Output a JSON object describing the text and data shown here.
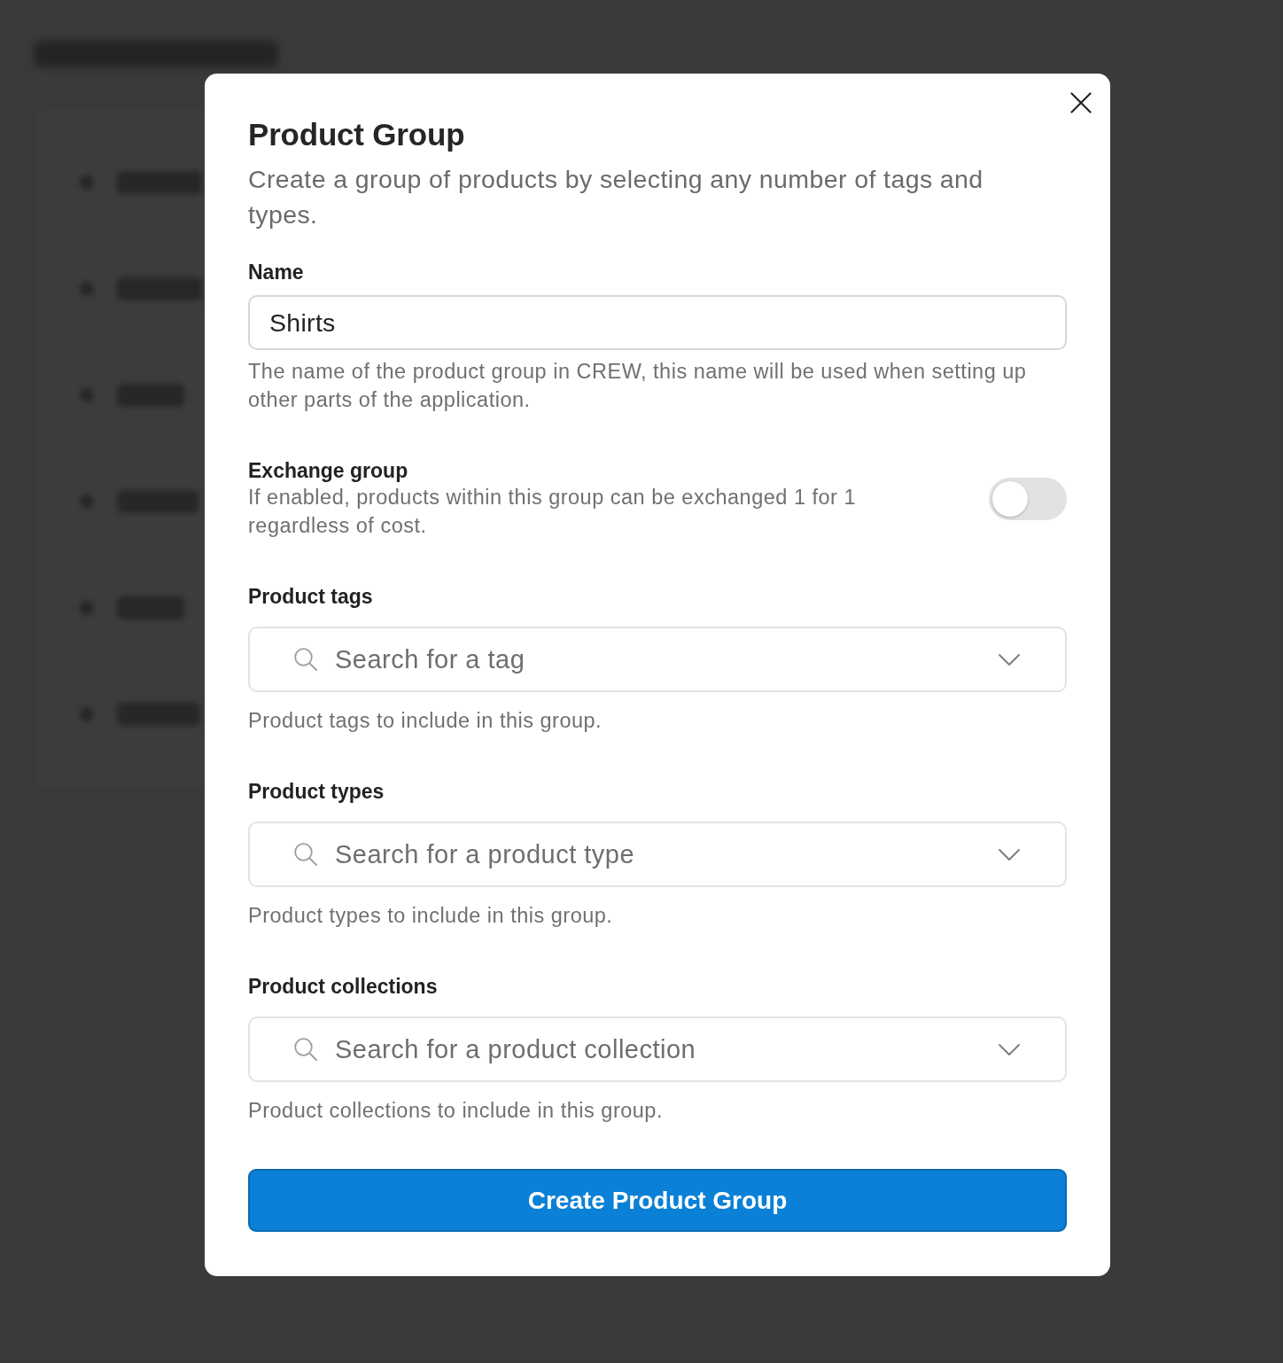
{
  "dialog": {
    "title": "Product Group",
    "subtitle": "Create a group of products by selecting any number of tags and types."
  },
  "fields": [
    {
      "kind": "text",
      "label": "Name",
      "value": "Shirts",
      "help": "The name of the product group in CREW, this name will be used when setting up other parts of the application."
    },
    {
      "kind": "toggle",
      "label": "Exchange group",
      "description": "If enabled, products within this group can be exchanged 1 for 1 regardless of cost.",
      "on": false
    },
    {
      "kind": "select",
      "label": "Product tags",
      "placeholder": "Search for a tag",
      "help": "Product tags to include in this group."
    },
    {
      "kind": "select",
      "label": "Product types",
      "placeholder": "Search for a product type",
      "help": "Product types to include in this group."
    },
    {
      "kind": "select",
      "label": "Product collections",
      "placeholder": "Search for a product collection",
      "help": "Product collections to include in this group."
    }
  ],
  "submit": "Create Product Group"
}
